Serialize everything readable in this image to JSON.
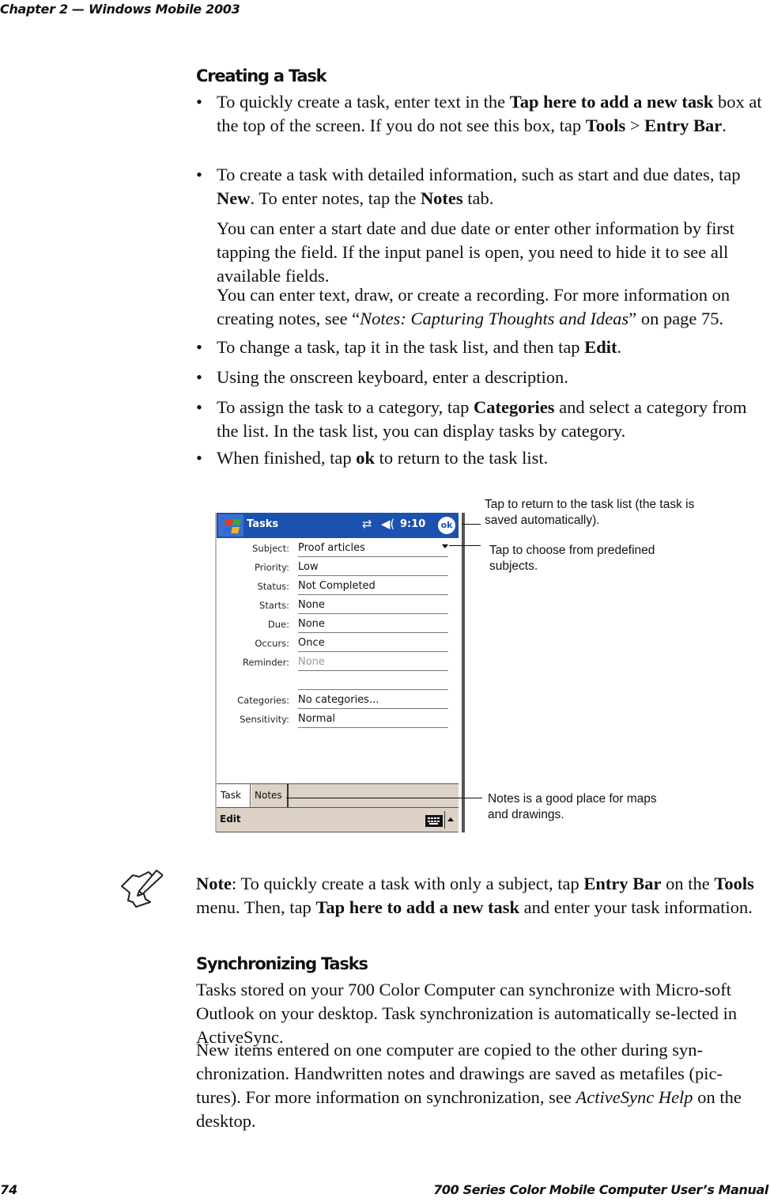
{
  "header": {
    "chapter": "Chapter 2  —  Windows Mobile 2003"
  },
  "footer": {
    "page_number": "74",
    "manual_title": "700 Series Color Mobile Computer User’s Manual"
  },
  "section1": {
    "title": "Creating a Task",
    "b1": {
      "t1": "To quickly create a task, enter text in the ",
      "b1": "Tap here to add a new task",
      "t2": " box at the top of the screen. If you do not see this box, tap ",
      "b2": "Tools",
      "t3": " > ",
      "b3": "Entry Bar",
      "t4": "."
    },
    "b2": {
      "t1": "To create a task with detailed information, such as start and due dates, tap ",
      "b1": "New",
      "t2": ". To enter notes, tap the ",
      "b2": "Notes",
      "t3": " tab."
    },
    "p1": "You can enter a start date and due date or enter other information by first tapping the field. If the input panel is open, you need to hide it to see all available fields.",
    "p2": {
      "t1": "You can enter text, draw, or create a recording. For more information on creating notes, see “",
      "i1": "Notes: Capturing Thoughts and Ideas",
      "t2": "” on page 75."
    },
    "b3": {
      "t1": "To change a task, tap it in the task list, and then tap ",
      "b1": "Edit",
      "t2": "."
    },
    "b4": "Using the onscreen keyboard, enter a description.",
    "b5": {
      "t1": "To assign the task to a category, tap ",
      "b1": "Categories",
      "t2": " and select a category from the list. In the task list, you can display tasks by category."
    },
    "b6": {
      "t1": "When finished, tap ",
      "b1": "ok",
      "t2": " to return to the task list."
    },
    "bullet_char": "•"
  },
  "device": {
    "title": "Tasks",
    "sync_icon": "⇄",
    "volume_icon": "◀(",
    "time": "9:10",
    "ok_label": "ok",
    "fields": [
      {
        "label": "Subject:",
        "value": "Proof articles"
      },
      {
        "label": "Priority:",
        "value": "Low"
      },
      {
        "label": "Status:",
        "value": "Not Completed"
      },
      {
        "label": "Starts:",
        "value": "None"
      },
      {
        "label": "Due:",
        "value": "None"
      },
      {
        "label": "Occurs:",
        "value": "Once"
      },
      {
        "label": "Reminder:",
        "value": "None"
      },
      {
        "label": "",
        "value": ""
      },
      {
        "label": "Categories:",
        "value": "No categories..."
      },
      {
        "label": "Sensitivity:",
        "value": "Normal"
      }
    ],
    "tabs": [
      "Task",
      "Notes"
    ],
    "menu_edit": "Edit",
    "colors": {
      "titlebar": "#1b52b0",
      "chrome": "#dcd2c6"
    }
  },
  "callouts": {
    "ok": "Tap to return to the task list (the task is saved automatically).",
    "subject": "Tap to choose from predefined subjects.",
    "notes": "Notes is a good place for maps and drawings."
  },
  "note": {
    "label": "Note",
    "t1": ": To quickly create a task with only a subject, tap ",
    "b1": "Entry Bar",
    "t2": " on the ",
    "b2": "Tools",
    "t3": " menu. Then, tap ",
    "b3": "Tap here to add a new task",
    "t4": " and enter your task information."
  },
  "section2": {
    "title": "Synchronizing Tasks",
    "p1": "Tasks stored on your 700 Color Computer can synchronize with Micro-soft Outlook on your desktop. Task synchronization is automatically se-lected in ActiveSync.",
    "p2": {
      "t1": "New items entered on one computer are copied to the other during syn-chronization. Handwritten notes and drawings are saved as metafiles (pic-tures). For more information on synchronization, see ",
      "i1": "ActiveSync Help",
      "t2": " on the desktop."
    }
  }
}
